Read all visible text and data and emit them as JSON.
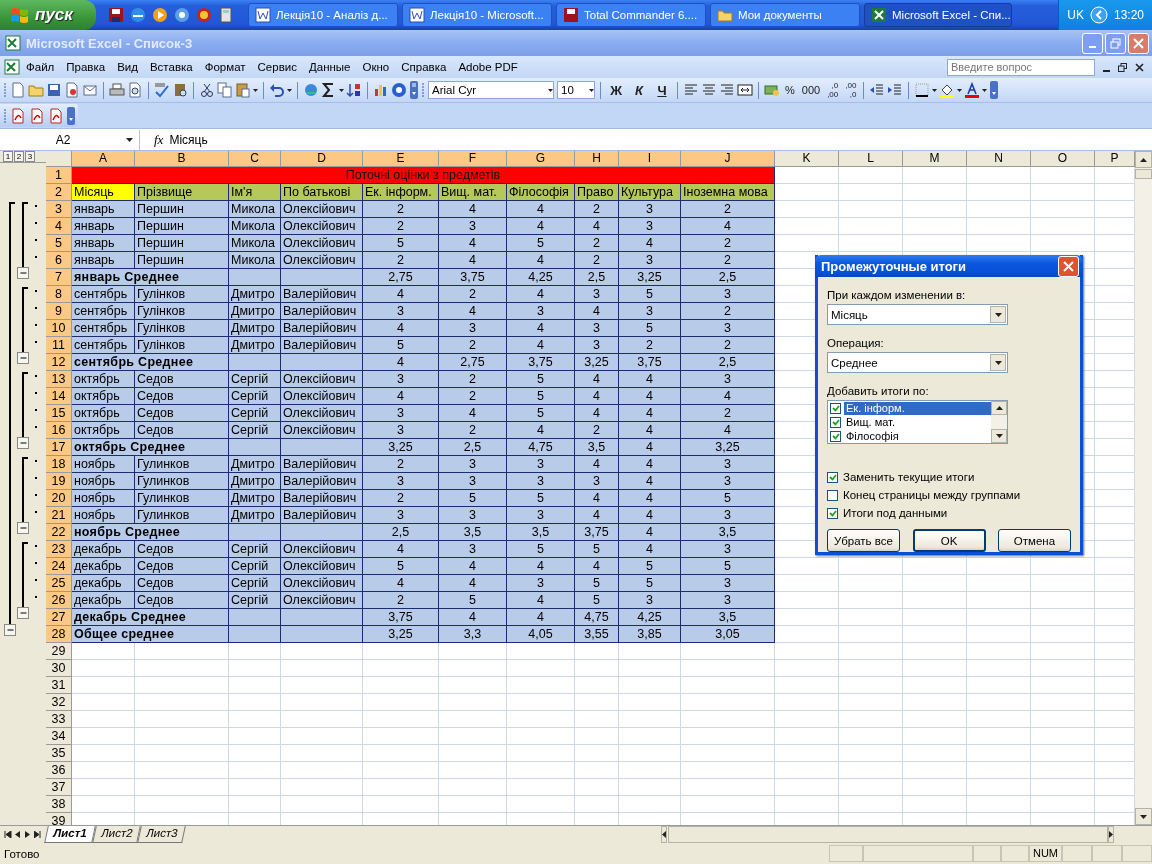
{
  "taskbar": {
    "start": "пуск",
    "tasks": [
      {
        "label": "Лекція10 - Аналіз д...",
        "selected": false
      },
      {
        "label": "Лекція10 - Microsoft...",
        "selected": false
      },
      {
        "label": "Total Commander 6....",
        "selected": false
      },
      {
        "label": "Мои документы",
        "selected": false
      },
      {
        "label": "Microsoft Excel - Спи...",
        "selected": true
      }
    ],
    "language": "UK",
    "clock": "13:20"
  },
  "window": {
    "title": "Microsoft Excel - Список-3"
  },
  "menu": {
    "items": [
      "Файл",
      "Правка",
      "Вид",
      "Вставка",
      "Формат",
      "Сервис",
      "Данные",
      "Окно",
      "Справка",
      "Adobe PDF"
    ],
    "help_search": {
      "placeholder": "Введите вопрос"
    }
  },
  "toolbar": {
    "font": "Arial Cyr",
    "font_size": "10",
    "style_buttons": [
      "Ж",
      "К",
      "Ч"
    ],
    "number_buttons": [
      "%",
      "000"
    ],
    "decimal_buttons": [
      {
        "top": ",0",
        "bottom": ",00"
      },
      {
        "top": ",00",
        "bottom": ",0"
      }
    ]
  },
  "formula_bar": {
    "name_box": "A2",
    "fx": "fx",
    "formula": "Місяць"
  },
  "sheet": {
    "outline_levels": [
      "1",
      "2",
      "3"
    ],
    "columns": [
      {
        "label": "A",
        "selected": true
      },
      {
        "label": "B",
        "selected": true
      },
      {
        "label": "C",
        "selected": true
      },
      {
        "label": "D",
        "selected": true
      },
      {
        "label": "E",
        "selected": true
      },
      {
        "label": "F",
        "selected": true
      },
      {
        "label": "G",
        "selected": true
      },
      {
        "label": "H",
        "selected": true
      },
      {
        "label": "I",
        "selected": true
      },
      {
        "label": "J",
        "selected": true
      },
      {
        "label": "K",
        "selected": false
      },
      {
        "label": "L",
        "selected": false
      },
      {
        "label": "M",
        "selected": false
      },
      {
        "label": "N",
        "selected": false
      },
      {
        "label": "O",
        "selected": false
      },
      {
        "label": "P",
        "selected": false
      }
    ],
    "rows": [
      {
        "number": "1",
        "selected": true,
        "kind": "title",
        "text": "Поточні оцінки з предметів"
      },
      {
        "number": "2",
        "selected": true,
        "kind": "header",
        "cells": [
          {
            "text": "Місяць",
            "selected": true
          },
          {
            "text": "Прізвище",
            "selected": false
          },
          {
            "text": "Ім'я",
            "selected": false
          },
          {
            "text": "По батькові",
            "selected": false
          },
          {
            "text": "Ек. інформ.",
            "selected": false
          },
          {
            "text": "Вищ. мат.",
            "selected": false
          },
          {
            "text": "Філософія",
            "selected": false
          },
          {
            "text": "Право",
            "selected": false
          },
          {
            "text": "Культура",
            "selected": false
          },
          {
            "text": "Іноземна мова",
            "selected": false
          }
        ]
      },
      {
        "number": "3",
        "selected": true,
        "kind": "data",
        "cells": [
          "январь",
          "Першин",
          "Микола",
          "Олексійович",
          "2",
          "4",
          "4",
          "2",
          "3",
          "2"
        ]
      },
      {
        "number": "4",
        "selected": true,
        "kind": "data",
        "cells": [
          "январь",
          "Першин",
          "Микола",
          "Олексійович",
          "2",
          "3",
          "4",
          "4",
          "3",
          "4"
        ]
      },
      {
        "number": "5",
        "selected": true,
        "kind": "data",
        "cells": [
          "январь",
          "Першин",
          "Микола",
          "Олексійович",
          "5",
          "4",
          "5",
          "2",
          "4",
          "2"
        ]
      },
      {
        "number": "6",
        "selected": true,
        "kind": "data",
        "cells": [
          "январь",
          "Першин",
          "Микола",
          "Олексійович",
          "2",
          "4",
          "4",
          "2",
          "3",
          "2"
        ]
      },
      {
        "number": "7",
        "selected": true,
        "kind": "subtotal",
        "label": "январь Среднее",
        "values": [
          "2,75",
          "3,75",
          "4,25",
          "2,5",
          "3,25",
          "2,5"
        ]
      },
      {
        "number": "8",
        "selected": true,
        "kind": "data",
        "cells": [
          "сентябрь",
          "Гулінков",
          "Дмитро",
          "Валерійович",
          "4",
          "2",
          "4",
          "3",
          "5",
          "3"
        ]
      },
      {
        "number": "9",
        "selected": true,
        "kind": "data",
        "cells": [
          "сентябрь",
          "Гулінков",
          "Дмитро",
          "Валерійович",
          "3",
          "4",
          "3",
          "4",
          "3",
          "2"
        ]
      },
      {
        "number": "10",
        "selected": true,
        "kind": "data",
        "cells": [
          "сентябрь",
          "Гулінков",
          "Дмитро",
          "Валерійович",
          "4",
          "3",
          "4",
          "3",
          "5",
          "3"
        ]
      },
      {
        "number": "11",
        "selected": true,
        "kind": "data",
        "cells": [
          "сентябрь",
          "Гулінков",
          "Дмитро",
          "Валерійович",
          "5",
          "2",
          "4",
          "3",
          "2",
          "2"
        ]
      },
      {
        "number": "12",
        "selected": true,
        "kind": "subtotal",
        "label": "сентябрь Среднее",
        "values": [
          "4",
          "2,75",
          "3,75",
          "3,25",
          "3,75",
          "2,5"
        ]
      },
      {
        "number": "13",
        "selected": true,
        "kind": "data",
        "cells": [
          "октябрь",
          "Седов",
          "Сергій",
          "Олексійович",
          "3",
          "2",
          "5",
          "4",
          "4",
          "3"
        ]
      },
      {
        "number": "14",
        "selected": true,
        "kind": "data",
        "cells": [
          "октябрь",
          "Седов",
          "Сергій",
          "Олексійович",
          "4",
          "2",
          "5",
          "4",
          "4",
          "4"
        ]
      },
      {
        "number": "15",
        "selected": true,
        "kind": "data",
        "cells": [
          "октябрь",
          "Седов",
          "Сергій",
          "Олексійович",
          "3",
          "4",
          "5",
          "4",
          "4",
          "2"
        ]
      },
      {
        "number": "16",
        "selected": true,
        "kind": "data",
        "cells": [
          "октябрь",
          "Седов",
          "Сергій",
          "Олексійович",
          "3",
          "2",
          "4",
          "2",
          "4",
          "4"
        ]
      },
      {
        "number": "17",
        "selected": true,
        "kind": "subtotal",
        "label": "октябрь Среднее",
        "values": [
          "3,25",
          "2,5",
          "4,75",
          "3,5",
          "4",
          "3,25"
        ]
      },
      {
        "number": "18",
        "selected": true,
        "kind": "data",
        "cells": [
          "ноябрь",
          "Гулинков",
          "Дмитро",
          "Валерійович",
          "2",
          "3",
          "3",
          "4",
          "4",
          "3"
        ]
      },
      {
        "number": "19",
        "selected": true,
        "kind": "data",
        "cells": [
          "ноябрь",
          "Гулинков",
          "Дмитро",
          "Валерійович",
          "3",
          "3",
          "3",
          "3",
          "4",
          "3"
        ]
      },
      {
        "number": "20",
        "selected": true,
        "kind": "data",
        "cells": [
          "ноябрь",
          "Гулинков",
          "Дмитро",
          "Валерійович",
          "2",
          "5",
          "5",
          "4",
          "4",
          "5"
        ]
      },
      {
        "number": "21",
        "selected": true,
        "kind": "data",
        "cells": [
          "ноябрь",
          "Гулинков",
          "Дмитро",
          "Валерійович",
          "3",
          "3",
          "3",
          "4",
          "4",
          "3"
        ]
      },
      {
        "number": "22",
        "selected": true,
        "kind": "subtotal",
        "label": "ноябрь Среднее",
        "values": [
          "2,5",
          "3,5",
          "3,5",
          "3,75",
          "4",
          "3,5"
        ]
      },
      {
        "number": "23",
        "selected": true,
        "kind": "data",
        "cells": [
          "декабрь",
          "Седов",
          "Сергій",
          "Олексійович",
          "4",
          "3",
          "5",
          "5",
          "4",
          "3"
        ]
      },
      {
        "number": "24",
        "selected": true,
        "kind": "data",
        "cells": [
          "декабрь",
          "Седов",
          "Сергій",
          "Олексійович",
          "5",
          "4",
          "4",
          "4",
          "5",
          "5"
        ]
      },
      {
        "number": "25",
        "selected": true,
        "kind": "data",
        "cells": [
          "декабрь",
          "Седов",
          "Сергій",
          "Олексійович",
          "4",
          "4",
          "3",
          "5",
          "5",
          "3"
        ]
      },
      {
        "number": "26",
        "selected": true,
        "kind": "data",
        "cells": [
          "декабрь",
          "Седов",
          "Сергій",
          "Олексійович",
          "2",
          "5",
          "4",
          "5",
          "3",
          "3"
        ]
      },
      {
        "number": "27",
        "selected": true,
        "kind": "subtotal",
        "label": "декабрь Среднее",
        "values": [
          "3,75",
          "4",
          "4",
          "4,75",
          "4,25",
          "3,5"
        ]
      },
      {
        "number": "28",
        "selected": true,
        "kind": "total",
        "label": "Общее среднее",
        "values": [
          "3,25",
          "3,3",
          "4,05",
          "3,55",
          "3,85",
          "3,05"
        ]
      },
      {
        "number": "29",
        "selected": false,
        "kind": "empty"
      },
      {
        "number": "30",
        "selected": false,
        "kind": "empty"
      },
      {
        "number": "31",
        "selected": false,
        "kind": "empty"
      },
      {
        "number": "32",
        "selected": false,
        "kind": "empty"
      },
      {
        "number": "33",
        "selected": false,
        "kind": "empty"
      },
      {
        "number": "34",
        "selected": false,
        "kind": "empty"
      },
      {
        "number": "35",
        "selected": false,
        "kind": "empty"
      },
      {
        "number": "36",
        "selected": false,
        "kind": "empty"
      },
      {
        "number": "37",
        "selected": false,
        "kind": "empty"
      },
      {
        "number": "38",
        "selected": false,
        "kind": "empty"
      },
      {
        "number": "39",
        "selected": false,
        "kind": "empty"
      }
    ]
  },
  "dialog": {
    "title": "Промежуточные итоги",
    "group_label": "При каждом изменении в:",
    "group_value": "Місяць",
    "operation_label": "Операция:",
    "operation_value": "Среднее",
    "columns_label": "Добавить итоги по:",
    "columns": [
      {
        "label": "Ек. інформ.",
        "checked": true,
        "selected": true
      },
      {
        "label": "Вищ. мат.",
        "checked": true,
        "selected": false
      },
      {
        "label": "Філософія",
        "checked": true,
        "selected": false
      }
    ],
    "options": [
      {
        "label": "Заменить текущие итоги",
        "checked": true
      },
      {
        "label": "Конец страницы между группами",
        "checked": false
      },
      {
        "label": "Итоги под данными",
        "checked": true
      }
    ],
    "buttons": [
      "Убрать все",
      "OK",
      "Отмена"
    ]
  },
  "sheet_tabs": [
    {
      "label": "Лист1",
      "selected": true
    },
    {
      "label": "Лист2",
      "selected": false
    },
    {
      "label": "Лист3",
      "selected": false
    }
  ],
  "status_bar": {
    "status": "Готово",
    "indicator": "NUM"
  }
}
